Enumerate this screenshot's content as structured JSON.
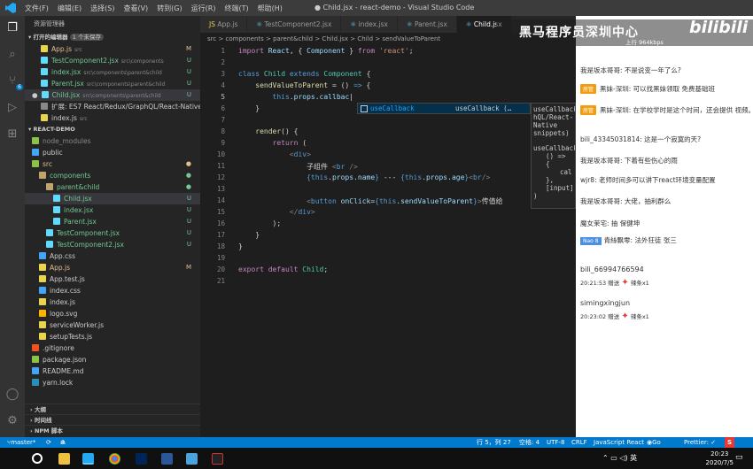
{
  "titlebar": {
    "menus": [
      "文件(F)",
      "编辑(E)",
      "选择(S)",
      "查看(V)",
      "转到(G)",
      "运行(R)",
      "终端(T)",
      "帮助(H)"
    ],
    "title": "● Child.jsx - react-demo - Visual Studio Code"
  },
  "activity": {
    "icons": [
      "files-icon",
      "search-icon",
      "source-control-icon",
      "run-icon",
      "extensions-icon",
      "account-icon",
      "settings-icon"
    ],
    "scm_badge": "6"
  },
  "sidebar": {
    "header": "资源管理器",
    "open_editors_label": "打开的编辑器",
    "open_editors_unsaved": "1 个未保存",
    "open_editors": [
      {
        "name": "App.js",
        "path": "src",
        "status": "M",
        "color": "#e2c08d",
        "icon_color": "#e8d44d"
      },
      {
        "name": "TestComponent2.jsx",
        "path": "src\\components",
        "status": "U",
        "color": "#73c991",
        "icon_color": "#61dafb"
      },
      {
        "name": "index.jsx",
        "path": "src\\components\\parent&child",
        "status": "U",
        "color": "#73c991",
        "icon_color": "#61dafb"
      },
      {
        "name": "Parent.jsx",
        "path": "src\\components\\parent&child",
        "status": "U",
        "color": "#73c991",
        "icon_color": "#61dafb"
      },
      {
        "name": "Child.jsx",
        "path": "src\\components\\parent&child",
        "status": "U",
        "color": "#73c991",
        "icon_color": "#61dafb"
      },
      {
        "name": "扩展: ES7 React/Redux/GraphQL/React-Native ...",
        "path": "",
        "status": "",
        "color": "#ccc",
        "icon_color": "#888"
      },
      {
        "name": "index.js",
        "path": "src",
        "status": "",
        "color": "#ccc",
        "icon_color": "#e8d44d"
      }
    ],
    "project_label": "REACT-DEMO",
    "tree": [
      {
        "name": "node_modules",
        "status": "",
        "color": "#888",
        "icon_color": "#8bc34a",
        "indent": 0
      },
      {
        "name": "public",
        "status": "",
        "color": "#ccc",
        "icon_color": "#42a5f5",
        "indent": 0
      },
      {
        "name": "src",
        "status": "●",
        "color": "#e2c08d",
        "icon_color": "#8bc34a",
        "indent": 0
      },
      {
        "name": "components",
        "status": "●",
        "color": "#73c991",
        "icon_color": "#c2a56d",
        "indent": 1
      },
      {
        "name": "parent&child",
        "status": "●",
        "color": "#73c991",
        "icon_color": "#c2a56d",
        "indent": 2
      },
      {
        "name": "Child.jsx",
        "status": "U",
        "color": "#73c991",
        "icon_color": "#61dafb",
        "indent": 3
      },
      {
        "name": "index.jsx",
        "status": "U",
        "color": "#73c991",
        "icon_color": "#61dafb",
        "indent": 3
      },
      {
        "name": "Parent.jsx",
        "status": "U",
        "color": "#73c991",
        "icon_color": "#61dafb",
        "indent": 3
      },
      {
        "name": "TestComponent.jsx",
        "status": "U",
        "color": "#73c991",
        "icon_color": "#61dafb",
        "indent": 2
      },
      {
        "name": "TestComponent2.jsx",
        "status": "U",
        "color": "#73c991",
        "icon_color": "#61dafb",
        "indent": 2
      },
      {
        "name": "App.css",
        "status": "",
        "color": "#ccc",
        "icon_color": "#42a5f5",
        "indent": 1
      },
      {
        "name": "App.js",
        "status": "M",
        "color": "#e2c08d",
        "icon_color": "#e8d44d",
        "indent": 1
      },
      {
        "name": "App.test.js",
        "status": "",
        "color": "#ccc",
        "icon_color": "#e8d44d",
        "indent": 1
      },
      {
        "name": "index.css",
        "status": "",
        "color": "#ccc",
        "icon_color": "#42a5f5",
        "indent": 1
      },
      {
        "name": "index.js",
        "status": "",
        "color": "#ccc",
        "icon_color": "#e8d44d",
        "indent": 1
      },
      {
        "name": "logo.svg",
        "status": "",
        "color": "#ccc",
        "icon_color": "#ffb300",
        "indent": 1
      },
      {
        "name": "serviceWorker.js",
        "status": "",
        "color": "#ccc",
        "icon_color": "#e8d44d",
        "indent": 1
      },
      {
        "name": "setupTests.js",
        "status": "",
        "color": "#ccc",
        "icon_color": "#e8d44d",
        "indent": 1
      },
      {
        "name": ".gitignore",
        "status": "",
        "color": "#ccc",
        "icon_color": "#f4511e",
        "indent": 0
      },
      {
        "name": "package.json",
        "status": "",
        "color": "#ccc",
        "icon_color": "#8bc34a",
        "indent": 0
      },
      {
        "name": "README.md",
        "status": "",
        "color": "#ccc",
        "icon_color": "#42a5f5",
        "indent": 0
      },
      {
        "name": "yarn.lock",
        "status": "",
        "color": "#ccc",
        "icon_color": "#2c8ebb",
        "indent": 0
      }
    ],
    "bottom_sections": [
      "大纲",
      "时间线",
      "NPM 脚本"
    ]
  },
  "tabs": [
    {
      "label": "App.js",
      "active": false
    },
    {
      "label": "TestComponent2.jsx",
      "active": false
    },
    {
      "label": "index.jsx",
      "active": false
    },
    {
      "label": "Parent.jsx",
      "active": false
    },
    {
      "label": "Child.jsx",
      "active": true
    }
  ],
  "breadcrumb": "src > components > parent&child > Child.jsx > Child > sendValueToParent",
  "suggestion": {
    "label": "useCallback",
    "detail": "useCallback (…"
  },
  "suggestion_detail": [
    "useCallback",
    "hQL/React-Native snippets)",
    "",
    "useCallback",
    "() => {",
    "cal",
    "},",
    "[input],",
    ")"
  ],
  "status": {
    "branch": "master*",
    "errors": "⊗ 0",
    "warnings": "⚠ 0",
    "position": "行 5，列 27",
    "spaces": "空格: 4",
    "encoding": "UTF-8",
    "eol": "CRLF",
    "language": "JavaScript React",
    "golive": "Go Live",
    "prettier": "Prettier: ✓"
  },
  "stream": {
    "title": "黑马程序员深圳中心",
    "logo": "bilibili",
    "speed": "上行 964kbps"
  },
  "chat": [
    {
      "type": "msg",
      "text": "我是坂本哥哥: 不是说变一年了么?",
      "badge": ""
    },
    {
      "type": "msg",
      "text": "黑妹-深圳: 可以找黑妹领取 免费基础班",
      "badge": "房管"
    },
    {
      "type": "msg",
      "text": "黑妹-深圳: 在学校学时是这个时间，还会提供 视频。",
      "badge": "房管"
    },
    {
      "type": "msg",
      "text": "bili_43345031814: 这是一个寂寞的天?",
      "badge": ""
    },
    {
      "type": "msg",
      "text": "我是坂本哥哥: 下着有些伤心的雨",
      "badge": ""
    },
    {
      "type": "msg",
      "text": "wjr8: 老师时间多可以讲下react环境变量配置",
      "badge": ""
    },
    {
      "type": "msg",
      "text": "我是坂本哥哥: 大佬，抽利群么",
      "badge": ""
    },
    {
      "type": "msg",
      "text": "魔女茉宅: 抽 保健坤",
      "badge": ""
    },
    {
      "type": "msg",
      "text": "青絲飘零: 法外狂徒 张三",
      "badge": "Nao 8"
    }
  ],
  "gifts": [
    {
      "user": "bili_66994766594",
      "time": "20:21:53",
      "action": "赠送",
      "gift": "辣条x1"
    },
    {
      "user": "simingxingjun",
      "time": "20:23:02",
      "action": "赠送",
      "gift": "辣条x1"
    }
  ],
  "clock": {
    "time": "20:23",
    "date": "2020/7/5"
  },
  "taskbar": {
    "ime": "英"
  }
}
